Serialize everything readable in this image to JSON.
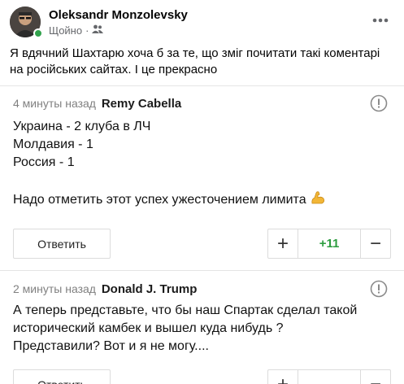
{
  "post": {
    "author": "Oleksandr Monzolevsky",
    "time": "Щойно",
    "separator": "·",
    "privacy_icon": "friends-icon",
    "text": "Я вдячний Шахтарю хоча б за те, що зміг почитати такі коментарі на російських сайтах. І це прекрасно"
  },
  "comments": [
    {
      "time": "4 минуты назад",
      "user": "Remy Cabella",
      "lines": [
        "Украина - 2 клуба в ЛЧ",
        "Молдавия - 1",
        "Россия - 1",
        "",
        "Надо отметить этот успех ужесточением лимита"
      ],
      "emoji": "flexed-biceps-icon",
      "reply_label": "Ответить",
      "plus": "+",
      "score": "+11",
      "minus": "−"
    },
    {
      "time": "2 минуты назад",
      "user": "Donald J. Trump",
      "lines": [
        "А теперь представьте, что бы наш Спартак сделал такой",
        "исторический камбек и вышел куда нибудь ?",
        "Представили? Вот и я не могу...."
      ],
      "reply_label": "Ответить",
      "plus": "+",
      "minus": "−"
    }
  ],
  "colors": {
    "score_positive": "#2c9c3f",
    "online": "#31a24c",
    "muted": "#65676b"
  }
}
